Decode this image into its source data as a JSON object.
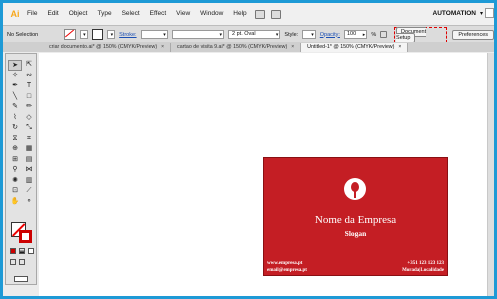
{
  "app": {
    "logo": "Ai",
    "workspace": "AUTOMATION"
  },
  "menu": [
    "File",
    "Edit",
    "Object",
    "Type",
    "Select",
    "Effect",
    "View",
    "Window",
    "Help"
  ],
  "control": {
    "selection": "No Selection",
    "stroke_label": "Stroke:",
    "brush": "2 pt. Oval",
    "style_label": "Style:",
    "opacity_label": "Opacity:",
    "opacity_value": "100",
    "opacity_unit": "%",
    "doc_setup": "Document Setup",
    "preferences": "Preferences"
  },
  "tabs": [
    {
      "label": "criar documento.ai* @ 150% (CMYK/Preview)",
      "active": false
    },
    {
      "label": "cartao de visita 9.ai* @ 150% (CMYK/Preview)",
      "active": false
    },
    {
      "label": "Untitled-1* @ 150% (CMYK/Preview)",
      "active": true
    }
  ],
  "card": {
    "company": "Nome da Empresa",
    "slogan": "Slogan",
    "website": "www.empresa.pt",
    "email": "email@empresa.pt",
    "phone": "+351 123 123 123",
    "address": "Morada|Localidade",
    "background": "#c41e24"
  }
}
